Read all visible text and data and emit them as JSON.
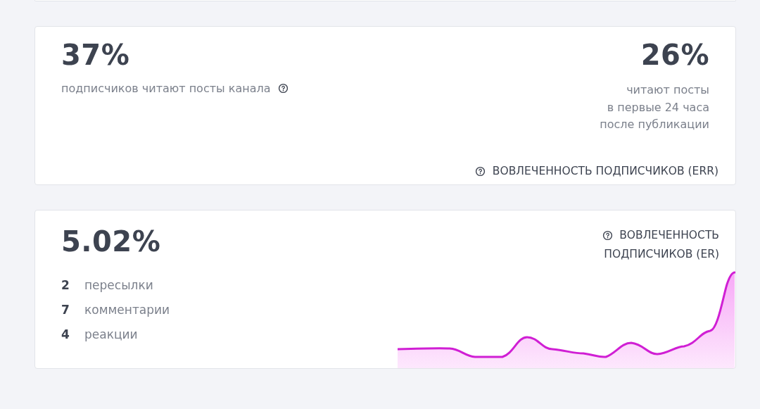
{
  "reach_card": {
    "value": "37%",
    "caption": "подписчиков читают посты канала",
    "day_value": "26%",
    "day_caption": [
      "читают посты",
      "в первые 24 часа",
      "после публикации"
    ],
    "footer": "ВОВЛЕЧЕННОСТЬ ПОДПИСЧИКОВ (ERR)"
  },
  "engagement_card": {
    "value": "5.02%",
    "title": [
      "ВОВЛЕЧЕННОСТЬ",
      "ПОДПИСЧИКОВ (ER)"
    ],
    "stats": [
      {
        "count": "2",
        "label": "пересылки"
      },
      {
        "count": "7",
        "label": "комментарии"
      },
      {
        "count": "4",
        "label": "реакции"
      }
    ]
  }
}
